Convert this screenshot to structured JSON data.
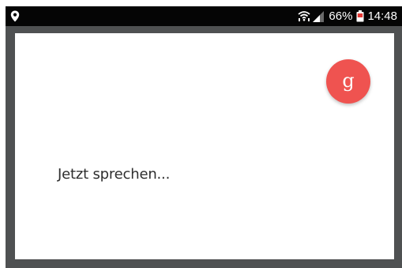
{
  "status_bar": {
    "battery_percent": "66%",
    "time": "14:48",
    "icons": [
      "location-icon",
      "wifi-icon",
      "signal-icon",
      "battery-icon"
    ]
  },
  "voice_dialog": {
    "prompt": "Jetzt sprechen...",
    "logo_letter": "g",
    "accent_color": "#ef5350"
  }
}
